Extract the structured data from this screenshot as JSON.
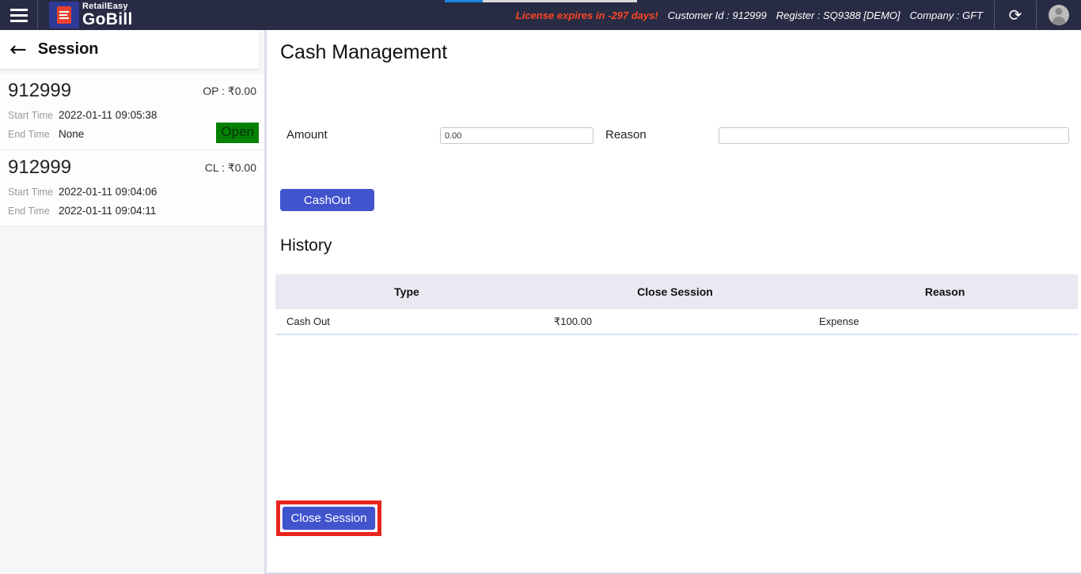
{
  "topbar": {
    "brand": {
      "name_top": "RetailEasy",
      "name_bottom": "GoBill"
    },
    "license_warning": "License expires in -297 days!",
    "customer_id": "Customer Id : 912999",
    "register": "Register : SQ9388 [DEMO]",
    "company": "Company : GFT"
  },
  "sidebar": {
    "title": "Session",
    "sessions": [
      {
        "id": "912999",
        "amount_label": "OP : ₹0.00",
        "start_label": "Start Time",
        "start_value": "2022-01-11 09:05:38",
        "end_label": "End Time",
        "end_value": "None",
        "status": "Open"
      },
      {
        "id": "912999",
        "amount_label": "CL : ₹0.00",
        "start_label": "Start Time",
        "start_value": "2022-01-11 09:04:06",
        "end_label": "End Time",
        "end_value": "2022-01-11 09:04:11"
      }
    ]
  },
  "main": {
    "title": "Cash Management",
    "form": {
      "amount_label": "Amount",
      "amount_value": "0.00",
      "reason_label": "Reason",
      "reason_value": "",
      "cashout_button": "CashOut"
    },
    "history": {
      "title": "History",
      "columns": [
        "Type",
        "Close Session",
        "Reason"
      ],
      "rows": [
        [
          "Cash Out",
          "₹100.00",
          "Expense"
        ]
      ]
    },
    "close_session_button": "Close Session"
  },
  "colors": {
    "topbar_bg": "#272b44",
    "accent_blue": "#4153cd",
    "badge_green": "#048104",
    "license_orange": "#ff4524",
    "highlight_red": "#e8251c",
    "progress_blue": "#1b84e0"
  }
}
